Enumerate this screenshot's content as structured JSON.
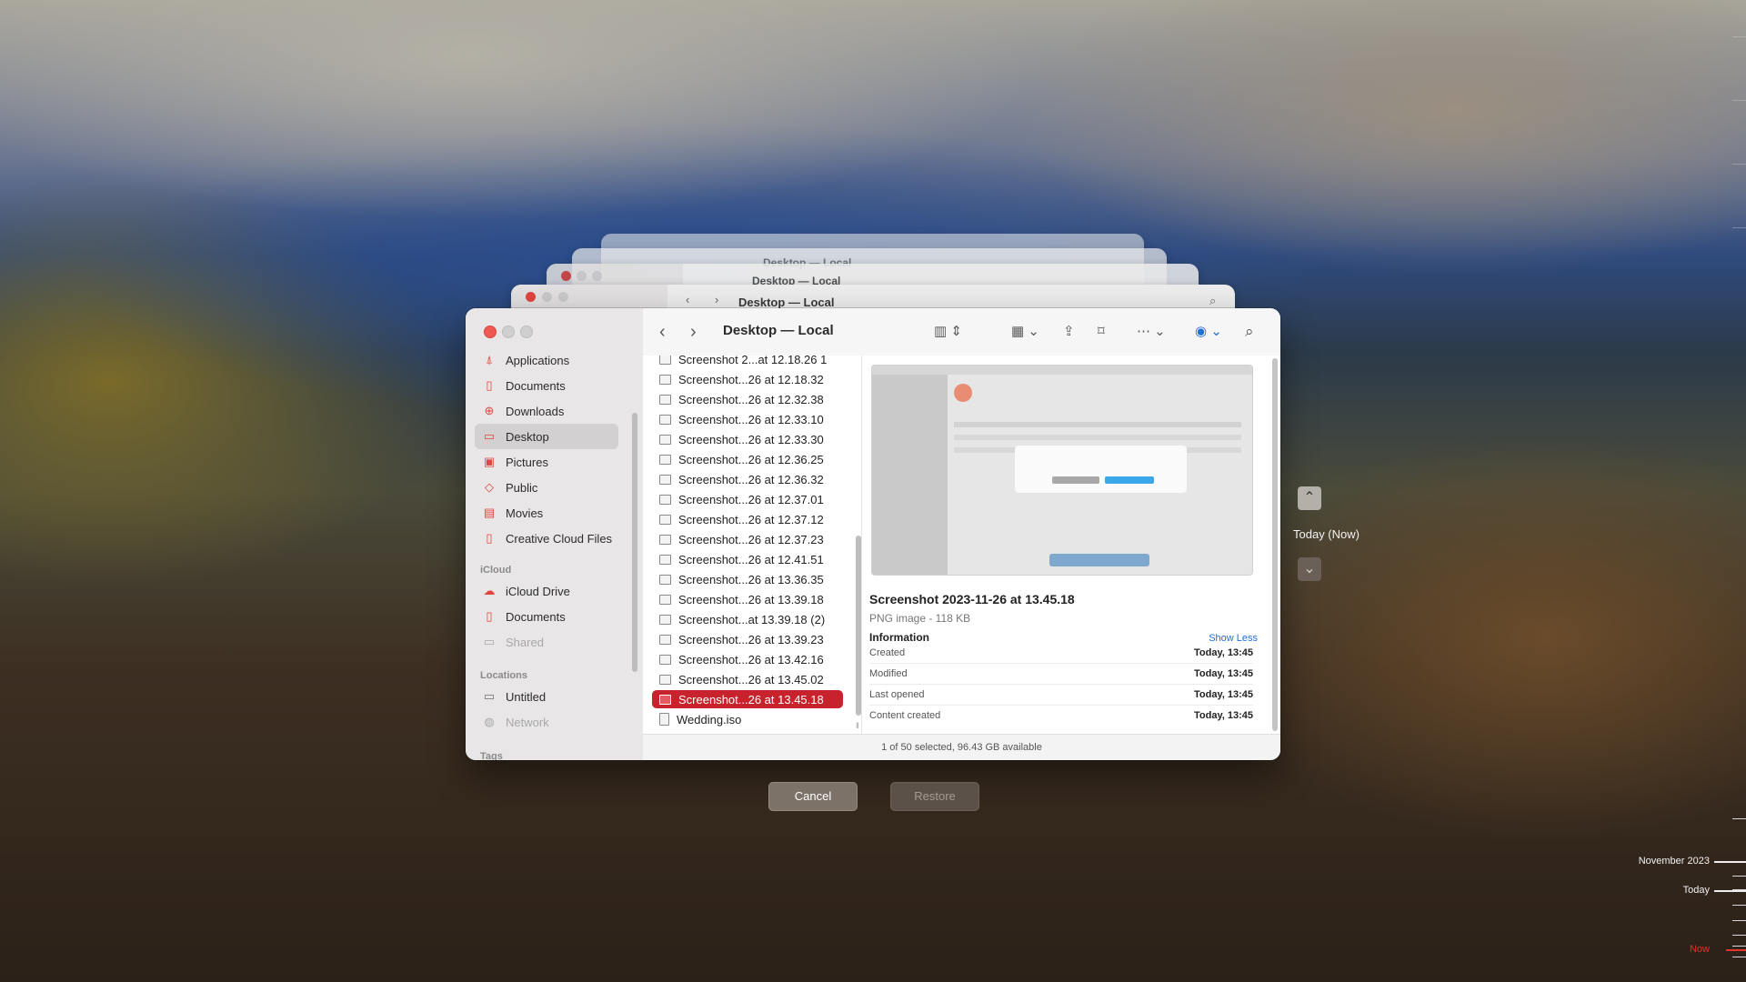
{
  "window": {
    "title": "Desktop — Local",
    "status": "1 of 50 selected, 96.43 GB available"
  },
  "sidebar": {
    "favorites": [
      {
        "label": "Applications",
        "icon": "applications-icon"
      },
      {
        "label": "Documents",
        "icon": "document-icon"
      },
      {
        "label": "Downloads",
        "icon": "downloads-icon"
      },
      {
        "label": "Desktop",
        "icon": "desktop-icon",
        "selected": true
      },
      {
        "label": "Pictures",
        "icon": "pictures-icon"
      },
      {
        "label": "Public",
        "icon": "public-icon"
      },
      {
        "label": "Movies",
        "icon": "movies-icon"
      },
      {
        "label": "Creative Cloud Files",
        "icon": "creative-cloud-icon"
      }
    ],
    "icloud_header": "iCloud",
    "icloud": [
      {
        "label": "iCloud Drive",
        "icon": "cloud-icon"
      },
      {
        "label": "Documents",
        "icon": "document-icon"
      },
      {
        "label": "Shared",
        "icon": "shared-folder-icon",
        "disabled": true
      }
    ],
    "locations_header": "Locations",
    "locations": [
      {
        "label": "Untitled",
        "icon": "drive-icon"
      },
      {
        "label": "Network",
        "icon": "network-icon",
        "disabled": true
      }
    ],
    "tags_header": "Tags"
  },
  "files": [
    "Screenshot 2...at 12.18.26 1",
    "Screenshot...26 at 12.18.32",
    "Screenshot...26 at 12.32.38",
    "Screenshot...26 at 12.33.10",
    "Screenshot...26 at 12.33.30",
    "Screenshot...26 at 12.36.25",
    "Screenshot...26 at 12.36.32",
    "Screenshot...26 at 12.37.01",
    "Screenshot...26 at 12.37.12",
    "Screenshot...26 at 12.37.23",
    "Screenshot...26 at 12.41.51",
    "Screenshot...26 at 13.36.35",
    "Screenshot...26 at 13.39.18",
    "Screenshot...at 13.39.18 (2)",
    "Screenshot...26 at 13.39.23",
    "Screenshot...26 at 13.42.16",
    "Screenshot...26 at 13.45.02",
    "Screenshot...26 at 13.45.18",
    "Wedding.iso"
  ],
  "selected_file_index": 17,
  "preview": {
    "name": "Screenshot 2023-11-26 at 13.45.18",
    "kind": "PNG image - 118 KB",
    "info_header": "Information",
    "show_less": "Show Less",
    "rows": [
      {
        "label": "Created",
        "value": "Today, 13:45"
      },
      {
        "label": "Modified",
        "value": "Today, 13:45"
      },
      {
        "label": "Last opened",
        "value": "Today, 13:45"
      },
      {
        "label": "Content created",
        "value": "Today, 13:45"
      }
    ]
  },
  "buttons": {
    "cancel": "Cancel",
    "restore": "Restore"
  },
  "timemachine": {
    "current": "Today (Now)",
    "timeline": {
      "month": "November 2023",
      "today": "Today",
      "now": "Now"
    }
  },
  "colors": {
    "selection": "#c8232c",
    "accent_red": "#e0453e",
    "link": "#1f6fd6",
    "now_marker": "#e5322b"
  }
}
